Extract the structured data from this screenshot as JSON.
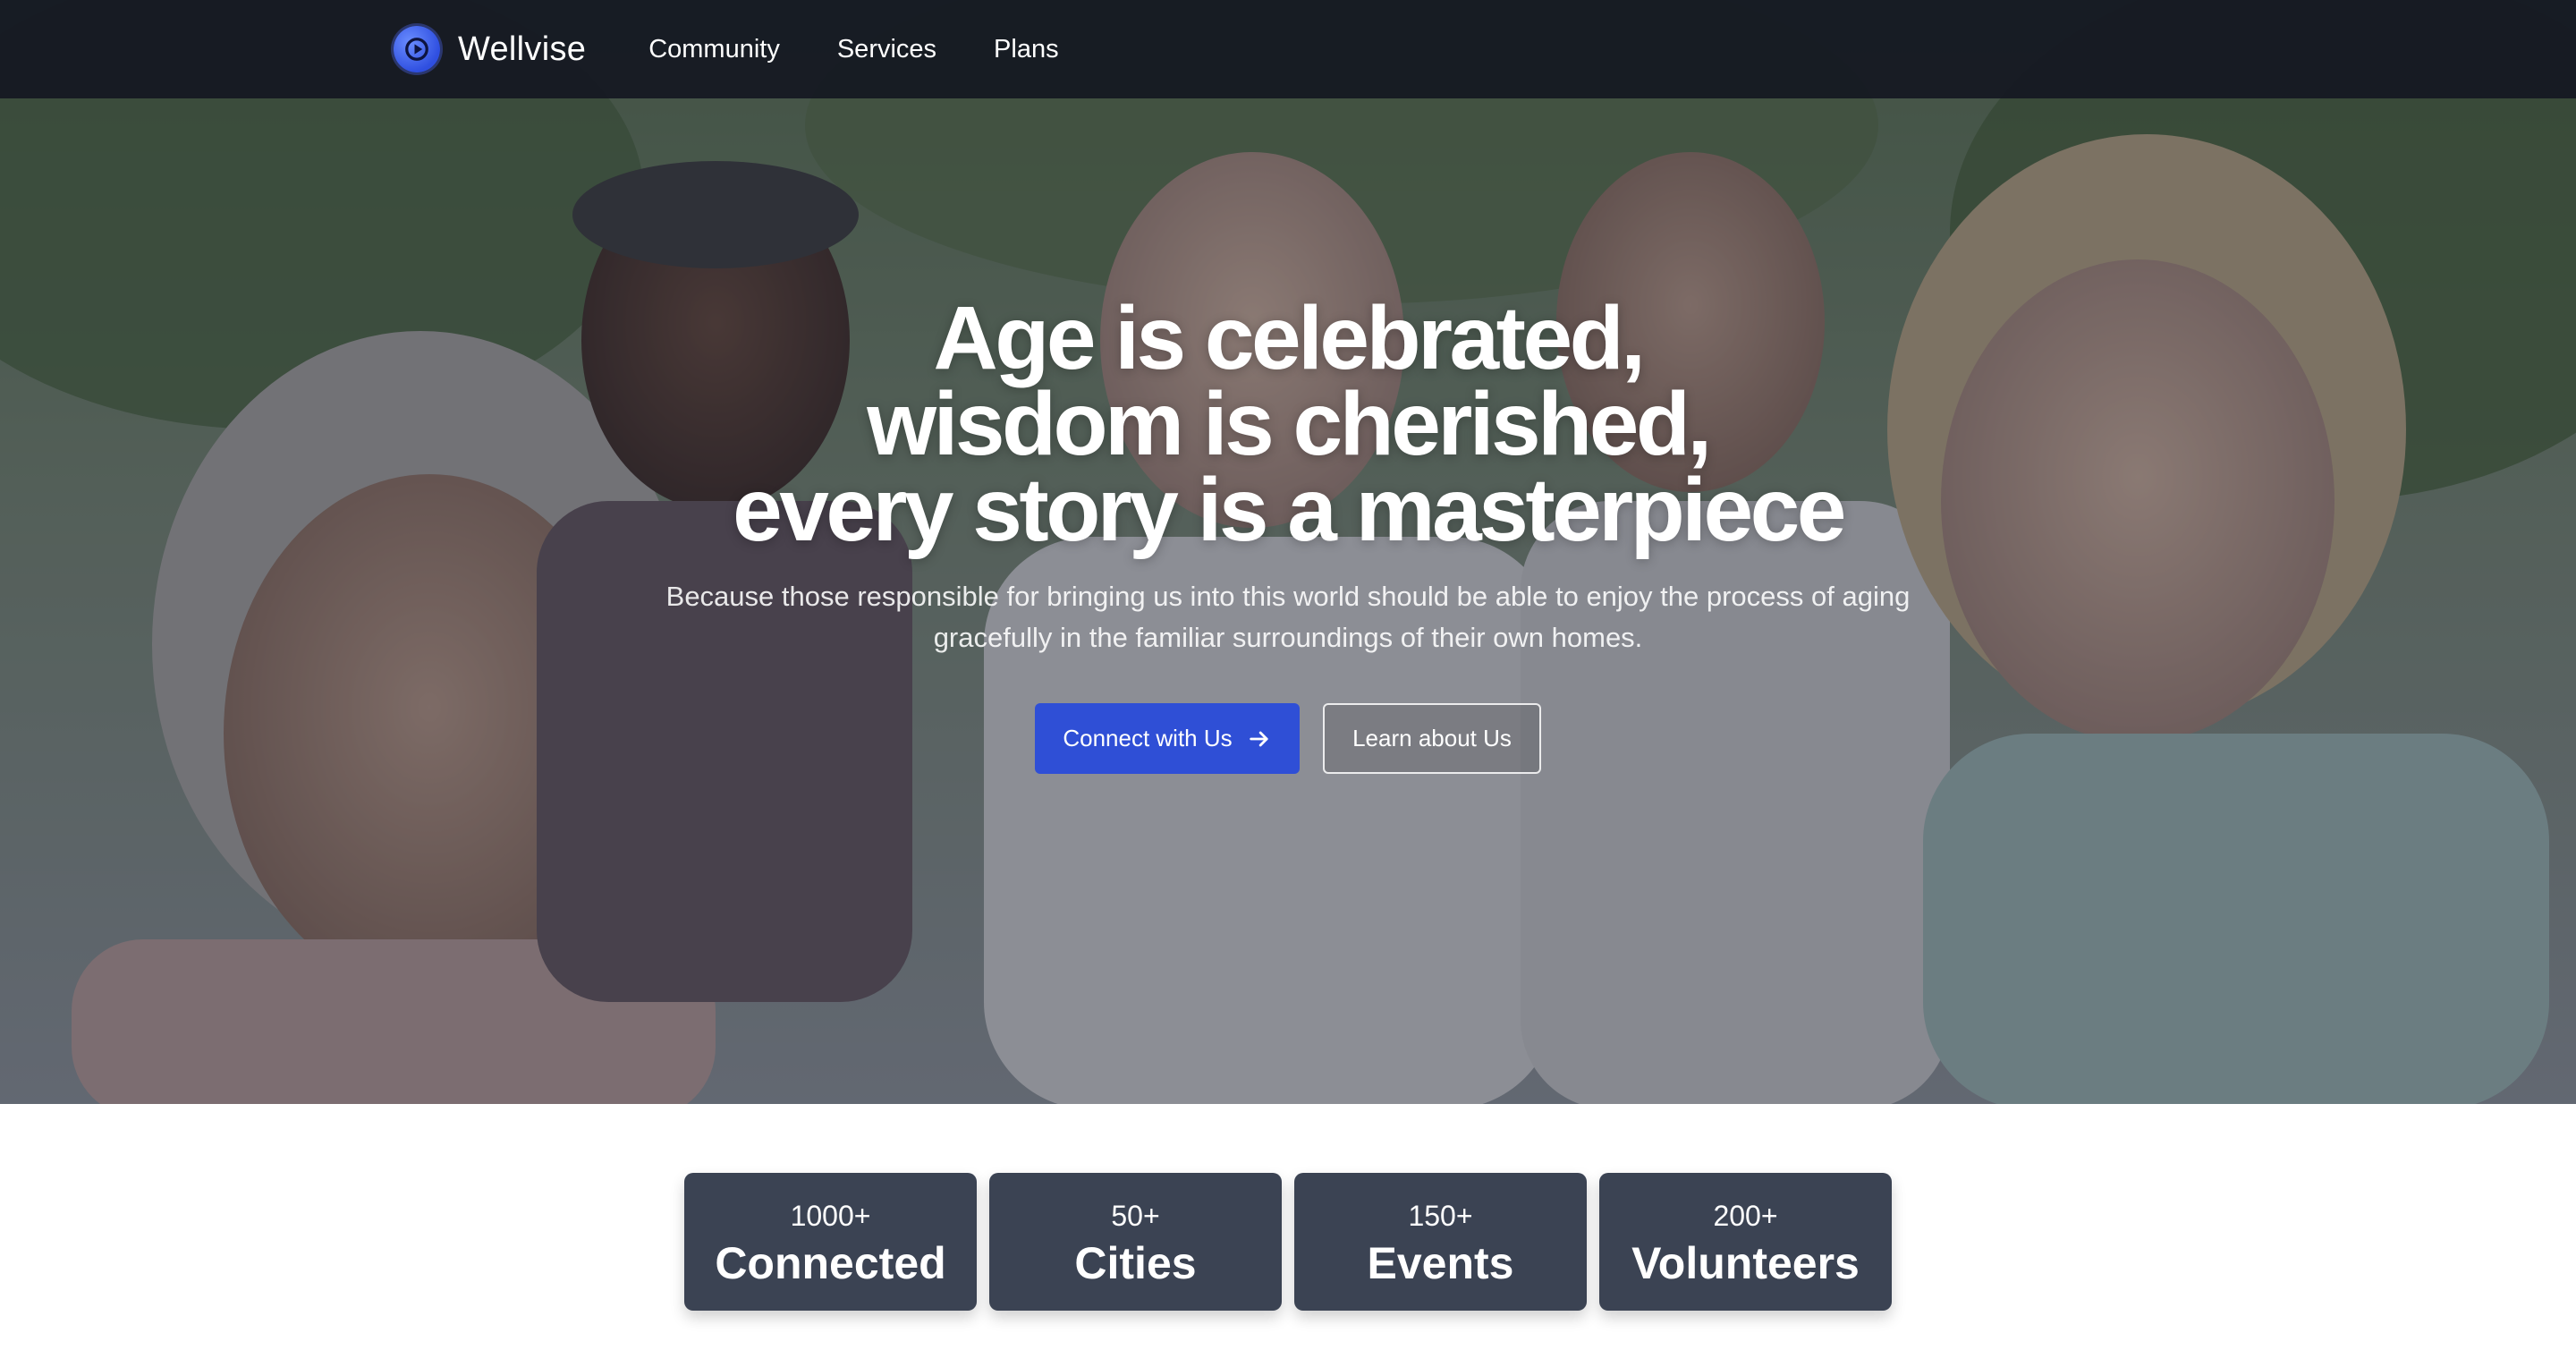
{
  "nav": {
    "brand": "Wellvise",
    "logo_icon": "play-circle-icon",
    "links": [
      "Community",
      "Services",
      "Plans"
    ]
  },
  "hero": {
    "headline": [
      "Age is celebrated,",
      "wisdom is cherished,",
      "every story is a masterpiece"
    ],
    "subtext": "Because those responsible for bringing us into this world should be able to enjoy the process of aging gracefully in the familiar surroundings of their own homes.",
    "primary_cta": "Connect with Us",
    "primary_cta_icon": "arrow-right-icon",
    "secondary_cta": "Learn about Us"
  },
  "stats": [
    {
      "number": "1000+",
      "label": "Connected"
    },
    {
      "number": "50+",
      "label": "Cities"
    },
    {
      "number": "150+",
      "label": "Events"
    },
    {
      "number": "200+",
      "label": "Volunteers"
    }
  ],
  "colors": {
    "accent": "#2f4fd6",
    "nav_bg": "#141821",
    "stat_card_bg": "#3b4353"
  }
}
